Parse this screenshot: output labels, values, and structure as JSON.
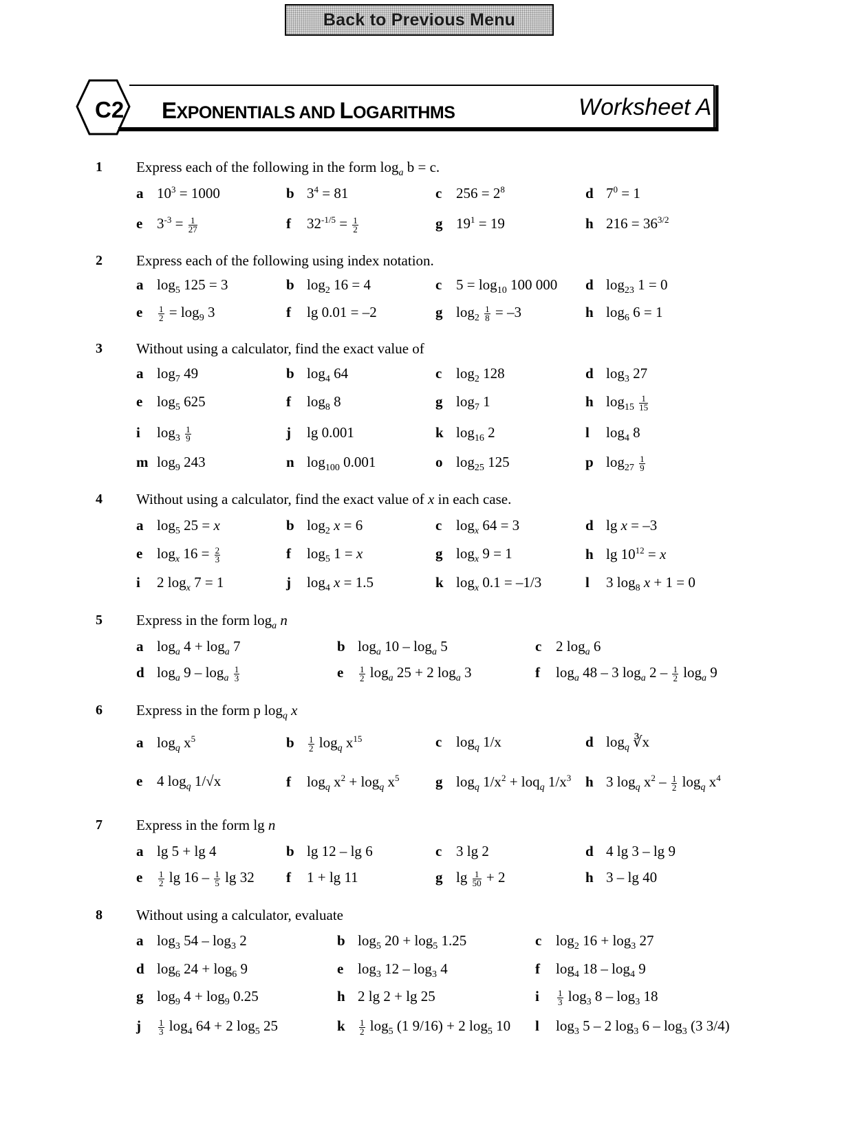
{
  "nav": {
    "back_label": "Back to Previous Menu"
  },
  "header": {
    "course_code": "C2",
    "title_word1_cap": "E",
    "title_word1_rest": "XPONENTIALS",
    "title_and": " AND ",
    "title_word2_cap": "L",
    "title_word2_rest": "OGARITHMS",
    "worksheet": "Worksheet A"
  },
  "questions": [
    {
      "number": "1",
      "prompt": "Express each of the following in the form  log_a b = c.",
      "items": [
        {
          "label": "a",
          "expr": "10^3 = 1000"
        },
        {
          "label": "b",
          "expr": "3^4 = 81"
        },
        {
          "label": "c",
          "expr": "256 = 2^8"
        },
        {
          "label": "d",
          "expr": "7^0 = 1"
        },
        {
          "label": "e",
          "expr": "3^-3 = 1/27"
        },
        {
          "label": "f",
          "expr": "32^(-1/5) = 1/2"
        },
        {
          "label": "g",
          "expr": "19^1 = 19"
        },
        {
          "label": "h",
          "expr": "216 = 36^(3/2)"
        }
      ]
    },
    {
      "number": "2",
      "prompt": "Express each of the following using index notation.",
      "items": [
        {
          "label": "a",
          "expr": "log_5 125 = 3"
        },
        {
          "label": "b",
          "expr": "log_2 16 = 4"
        },
        {
          "label": "c",
          "expr": "5 = log_10 100 000"
        },
        {
          "label": "d",
          "expr": "log_23 1 = 0"
        },
        {
          "label": "e",
          "expr": "1/2 = log_9 3"
        },
        {
          "label": "f",
          "expr": "lg 0.01 = –2"
        },
        {
          "label": "g",
          "expr": "log_2 1/8 = –3"
        },
        {
          "label": "h",
          "expr": "log_6 6 = 1"
        }
      ]
    },
    {
      "number": "3",
      "prompt": "Without using a calculator, find the exact value of",
      "items": [
        {
          "label": "a",
          "expr": "log_7 49"
        },
        {
          "label": "b",
          "expr": "log_4 64"
        },
        {
          "label": "c",
          "expr": "log_2 128"
        },
        {
          "label": "d",
          "expr": "log_3 27"
        },
        {
          "label": "e",
          "expr": "log_5 625"
        },
        {
          "label": "f",
          "expr": "log_8 8"
        },
        {
          "label": "g",
          "expr": "log_7 1"
        },
        {
          "label": "h",
          "expr": "log_15 1/15"
        },
        {
          "label": "i",
          "expr": "log_3 1/9"
        },
        {
          "label": "j",
          "expr": "lg 0.001"
        },
        {
          "label": "k",
          "expr": "log_16 2"
        },
        {
          "label": "l",
          "expr": "log_4 8"
        },
        {
          "label": "m",
          "expr": "log_9 243"
        },
        {
          "label": "n",
          "expr": "log_100 0.001"
        },
        {
          "label": "o",
          "expr": "log_25 125"
        },
        {
          "label": "p",
          "expr": "log_27 1/9"
        }
      ]
    },
    {
      "number": "4",
      "prompt": "Without using a calculator, find the exact value of x in each case.",
      "items": [
        {
          "label": "a",
          "expr": "log_5 25 = x"
        },
        {
          "label": "b",
          "expr": "log_2 x = 6"
        },
        {
          "label": "c",
          "expr": "log_x 64 = 3"
        },
        {
          "label": "d",
          "expr": "lg x = –3"
        },
        {
          "label": "e",
          "expr": "log_x 16 = 2/3"
        },
        {
          "label": "f",
          "expr": "log_5 1 = x"
        },
        {
          "label": "g",
          "expr": "log_x 9 = 1"
        },
        {
          "label": "h",
          "expr": "lg 10^12 = x"
        },
        {
          "label": "i",
          "expr": "2 log_x 7 = 1"
        },
        {
          "label": "j",
          "expr": "log_4 x = 1.5"
        },
        {
          "label": "k",
          "expr": "log_x 0.1 = –1/3"
        },
        {
          "label": "l",
          "expr": "3 log_8 x + 1 = 0"
        }
      ]
    },
    {
      "number": "5",
      "prompt": "Express in the form  log_a n",
      "items": [
        {
          "label": "a",
          "expr": "log_a 4 + log_a 7"
        },
        {
          "label": "b",
          "expr": "log_a 10 – log_a 5"
        },
        {
          "label": "c",
          "expr": "2 log_a 6"
        },
        {
          "label": "d",
          "expr": "log_a 9 – log_a 1/3"
        },
        {
          "label": "e",
          "expr": "1/2 log_a 25 + 2 log_a 3"
        },
        {
          "label": "f",
          "expr": "log_a 48 – 3 log_a 2 – 1/2 log_a 9"
        }
      ]
    },
    {
      "number": "6",
      "prompt": "Express in the form  p log_q x",
      "items": [
        {
          "label": "a",
          "expr": "log_q x^5"
        },
        {
          "label": "b",
          "expr": "1/2 log_q x^15"
        },
        {
          "label": "c",
          "expr": "log_q 1/x"
        },
        {
          "label": "d",
          "expr": "log_q ∛x"
        },
        {
          "label": "e",
          "expr": "4 log_q 1/√x"
        },
        {
          "label": "f",
          "expr": "log_q x^2 + log_q x^5"
        },
        {
          "label": "g",
          "expr": "log_q 1/x^2 + loq_q 1/x^3"
        },
        {
          "label": "h",
          "expr": "3 log_q x^2 – 1/2 log_q x^4"
        }
      ]
    },
    {
      "number": "7",
      "prompt": "Express in the form  lg n",
      "items": [
        {
          "label": "a",
          "expr": "lg 5 + lg 4"
        },
        {
          "label": "b",
          "expr": "lg 12 – lg 6"
        },
        {
          "label": "c",
          "expr": "3 lg 2"
        },
        {
          "label": "d",
          "expr": "4 lg 3 – lg 9"
        },
        {
          "label": "e",
          "expr": "1/2 lg 16 – 1/5 lg 32"
        },
        {
          "label": "f",
          "expr": "1 + lg 11"
        },
        {
          "label": "g",
          "expr": "lg 1/50 + 2"
        },
        {
          "label": "h",
          "expr": "3 – lg 40"
        }
      ]
    },
    {
      "number": "8",
      "prompt": "Without using a calculator, evaluate",
      "items": [
        {
          "label": "a",
          "expr": "log_3 54 – log_3 2"
        },
        {
          "label": "b",
          "expr": "log_5 20 + log_5 1.25"
        },
        {
          "label": "c",
          "expr": "log_2 16 + log_3 27"
        },
        {
          "label": "d",
          "expr": "log_6 24 + log_6 9"
        },
        {
          "label": "e",
          "expr": "log_3 12 – log_3 4"
        },
        {
          "label": "f",
          "expr": "log_4 18 – log_4 9"
        },
        {
          "label": "g",
          "expr": "log_9 4 + log_9 0.25"
        },
        {
          "label": "h",
          "expr": "2 lg 2 + lg 25"
        },
        {
          "label": "i",
          "expr": "1/3 log_3 8 – log_3 18"
        },
        {
          "label": "j",
          "expr": "1/3 log_4 64 + 2 log_5 25"
        },
        {
          "label": "k",
          "expr": "1/2 log_5 (1 9/16) + 2 log_5 10"
        },
        {
          "label": "l",
          "expr": "log_3 5 – 2 log_3 6 – log_3 (3 3/4)"
        }
      ]
    }
  ]
}
